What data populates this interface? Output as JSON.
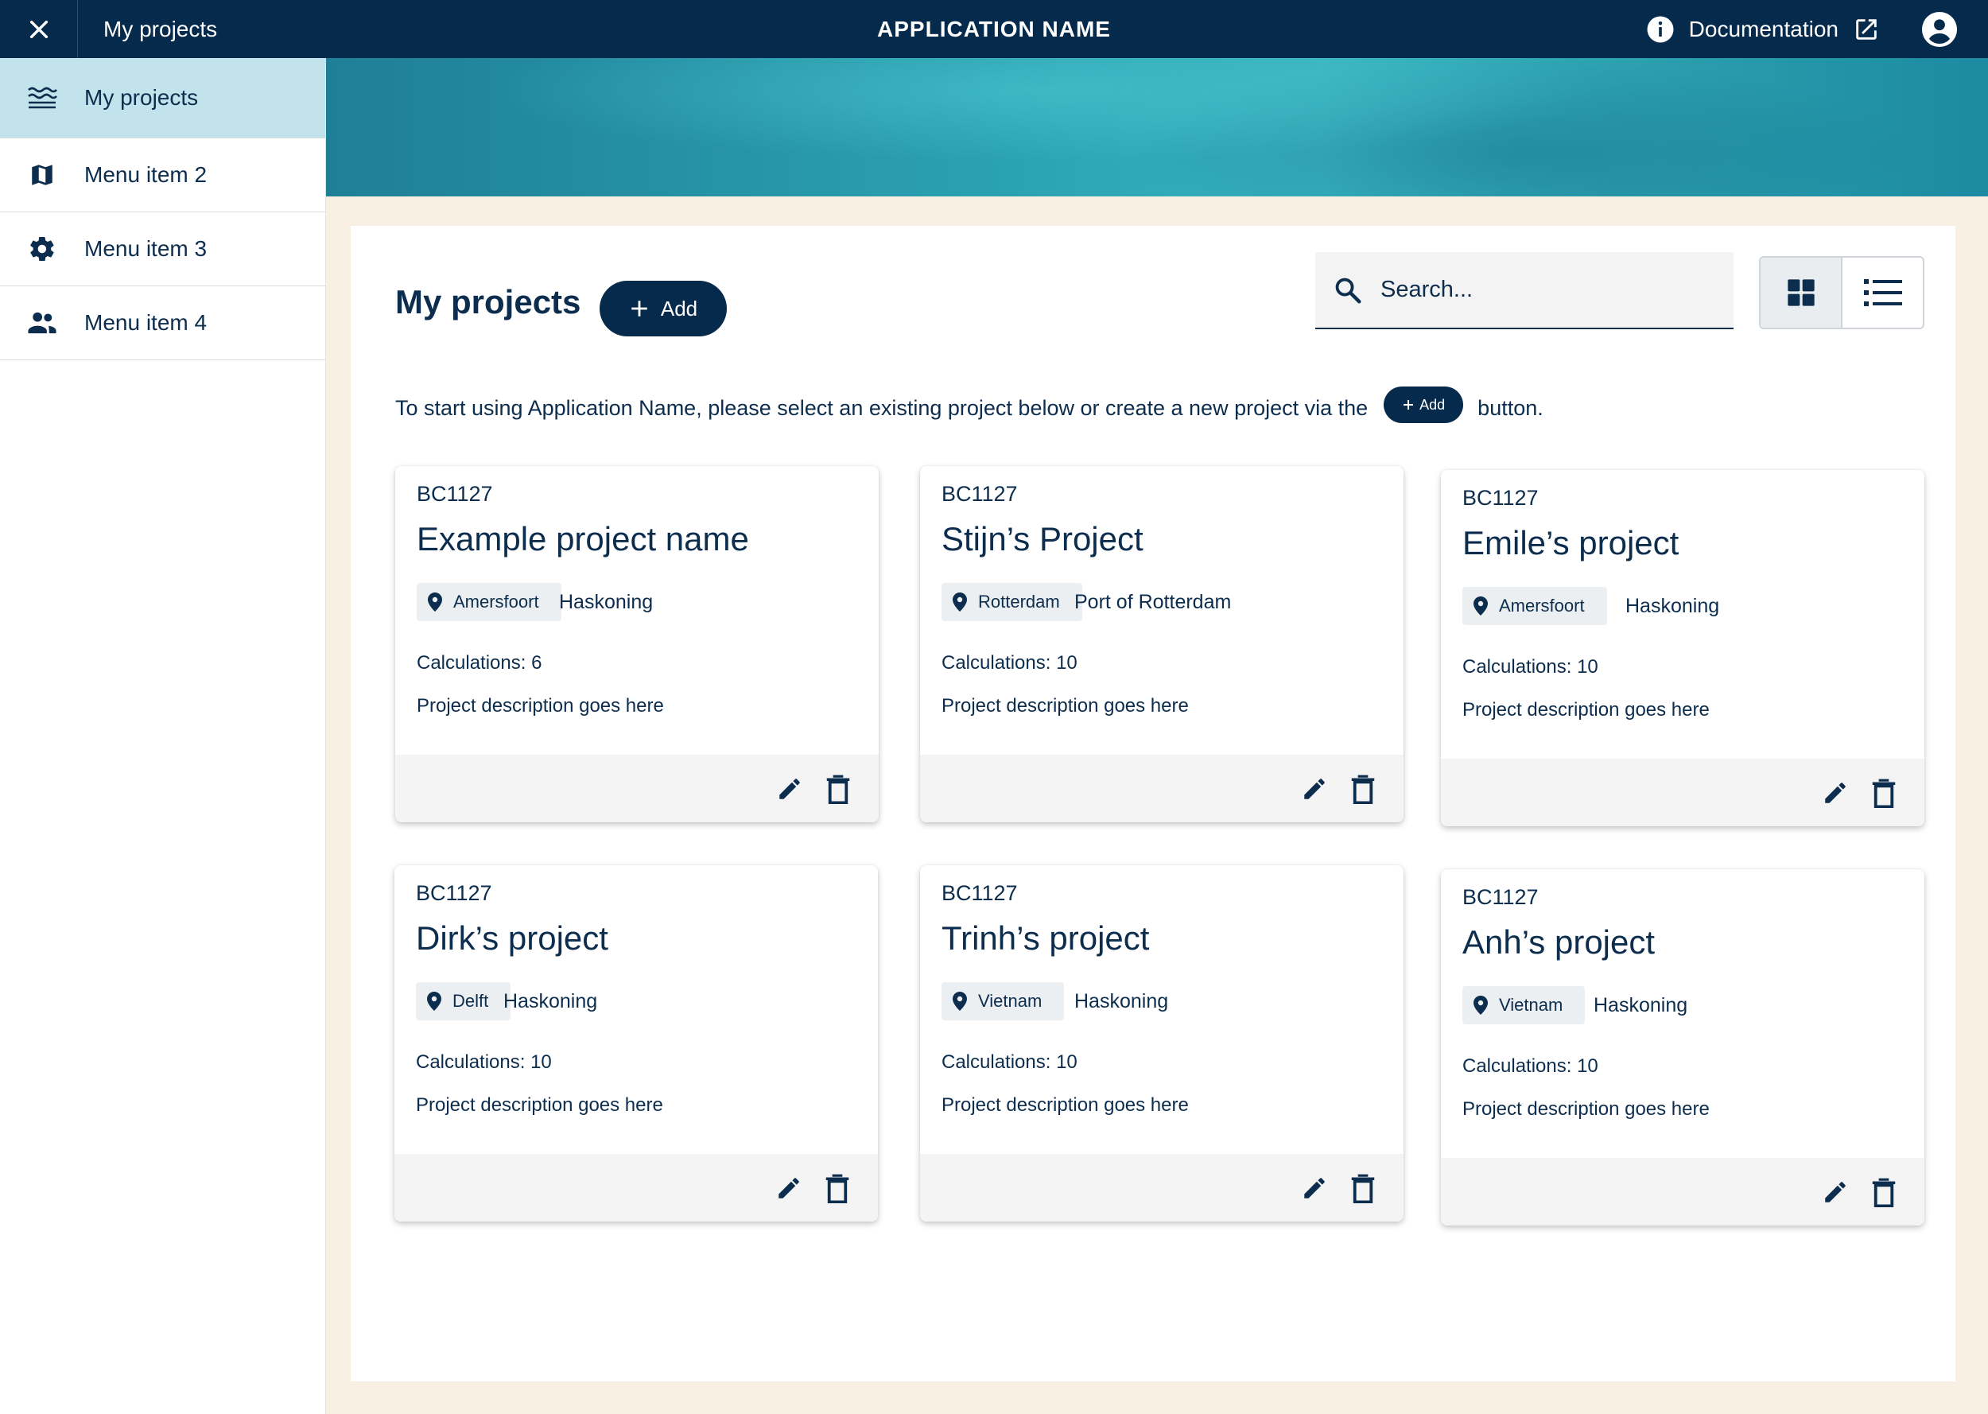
{
  "topbar": {
    "breadcrumb": "My projects",
    "app_name": "APPLICATION NAME",
    "documentation": "Documentation"
  },
  "sidebar": {
    "items": [
      {
        "label": "My projects",
        "icon": "waves-icon",
        "active": true
      },
      {
        "label": "Menu item 2",
        "icon": "map-icon",
        "active": false
      },
      {
        "label": "Menu item 3",
        "icon": "gear-icon",
        "active": false
      },
      {
        "label": "Menu item 4",
        "icon": "people-icon",
        "active": false
      }
    ]
  },
  "main": {
    "title": "My projects",
    "add_label": "Add",
    "search_placeholder": "Search...",
    "intro_before": "To start using Application Name, please select an existing project below or create a new project via the",
    "intro_button": "Add",
    "intro_after": "button.",
    "projects": [
      {
        "code": "BC1127",
        "name": "Example project name",
        "location": "Amersfoort",
        "client": "Haskoning",
        "calculations": "Calculations: 6",
        "description": "Project description goes here"
      },
      {
        "code": "BC1127",
        "name": "Stijn’s Project",
        "location": "Rotterdam",
        "client": "Port of Rotterdam",
        "calculations": "Calculations: 10",
        "description": "Project description goes here"
      },
      {
        "code": "BC1127",
        "name": "Emile’s project",
        "location": "Amersfoort",
        "client": "Haskoning",
        "calculations": "Calculations: 10",
        "description": "Project description goes here"
      },
      {
        "code": "BC1127",
        "name": "Dirk’s project",
        "location": "Delft",
        "client": "Haskoning",
        "calculations": "Calculations: 10",
        "description": "Project description goes here"
      },
      {
        "code": "BC1127",
        "name": "Trinh’s project",
        "location": "Vietnam",
        "client": "Haskoning",
        "calculations": "Calculations: 10",
        "description": "Project description goes here"
      },
      {
        "code": "BC1127",
        "name": "Anh’s project",
        "location": "Vietnam",
        "client": "Haskoning",
        "calculations": "Calculations: 10",
        "description": "Project description goes here"
      }
    ]
  },
  "colors": {
    "navy": "#062a4c",
    "active_nav": "#c3e3ec",
    "cream": "#f8f0e2",
    "teal": "#2aa1b1"
  }
}
